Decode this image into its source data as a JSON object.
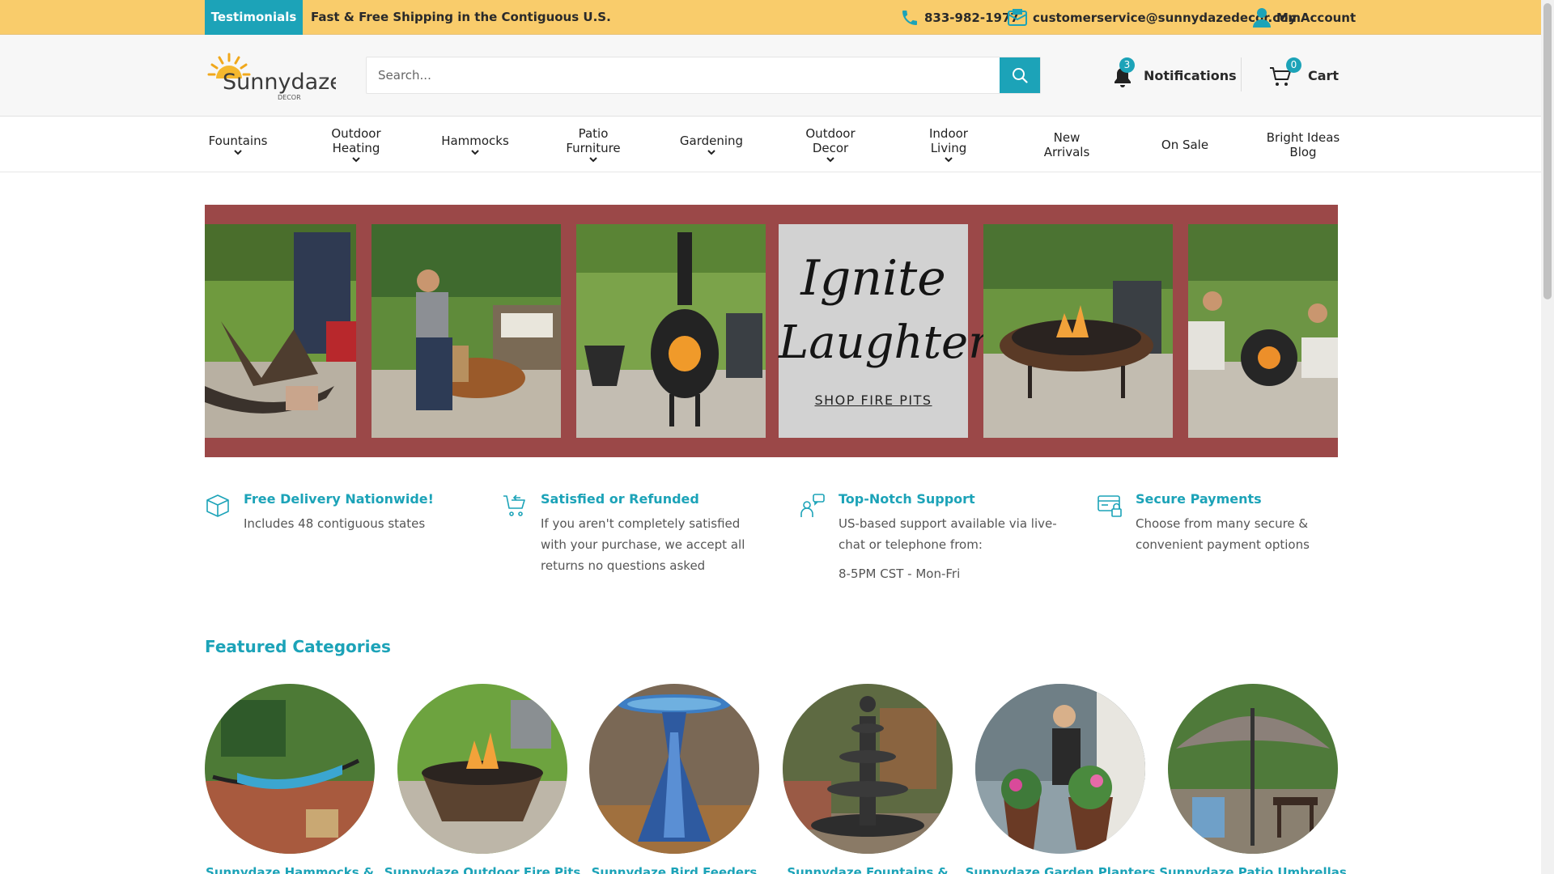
{
  "topbar": {
    "testimonials": "Testimonials",
    "shipping": "Fast & Free Shipping in the Contiguous U.S.",
    "phone": "833-982-1977",
    "email": "customerservice@sunnydazedecor.com",
    "account": "My Account"
  },
  "header": {
    "logo_text": "Sunnydaze",
    "logo_sub": "DECOR",
    "search_placeholder": "Search...",
    "notifications_label": "Notifications",
    "notifications_count": "3",
    "cart_label": "Cart",
    "cart_count": "0"
  },
  "nav": {
    "items": [
      {
        "label": "Fountains",
        "dropdown": true
      },
      {
        "label": "Outdoor\nHeating",
        "dropdown": true
      },
      {
        "label": "Hammocks",
        "dropdown": true
      },
      {
        "label": "Patio\nFurniture",
        "dropdown": true
      },
      {
        "label": "Gardening",
        "dropdown": true
      },
      {
        "label": "Outdoor\nDecor",
        "dropdown": true
      },
      {
        "label": "Indoor\nLiving",
        "dropdown": true
      },
      {
        "label": "New\nArrivals",
        "dropdown": false
      },
      {
        "label": "On Sale",
        "dropdown": false
      },
      {
        "label": "Bright Ideas\nBlog",
        "dropdown": false
      }
    ]
  },
  "hero": {
    "script_line1": "Ignite",
    "script_line2": "Laughter",
    "cta": "SHOP FIRE PITS"
  },
  "features": [
    {
      "title": "Free Delivery Nationwide!",
      "desc": "Includes 48 contiguous states",
      "extra": ""
    },
    {
      "title": "Satisfied or Refunded",
      "desc": "If you aren't completely satisfied with your purchase, we accept all returns no questions asked",
      "extra": ""
    },
    {
      "title": "Top-Notch Support",
      "desc": "US-based support available via live-chat or telephone from:",
      "extra": "8-5PM CST - Mon-Fri"
    },
    {
      "title": "Secure Payments",
      "desc": "Choose from many secure & convenient payment options",
      "extra": ""
    }
  ],
  "featured": {
    "title": "Featured Categories",
    "categories": [
      "Sunnydaze Hammocks &",
      "Sunnydaze Outdoor Fire Pits",
      "Sunnydaze Bird Feeders",
      "Sunnydaze Fountains &",
      "Sunnydaze Garden Planters",
      "Sunnydaze Patio Umbrellas"
    ]
  },
  "colors": {
    "accent": "#1ca3b8",
    "topbar": "#f9cc6b",
    "hero_frame": "#9b4848"
  }
}
